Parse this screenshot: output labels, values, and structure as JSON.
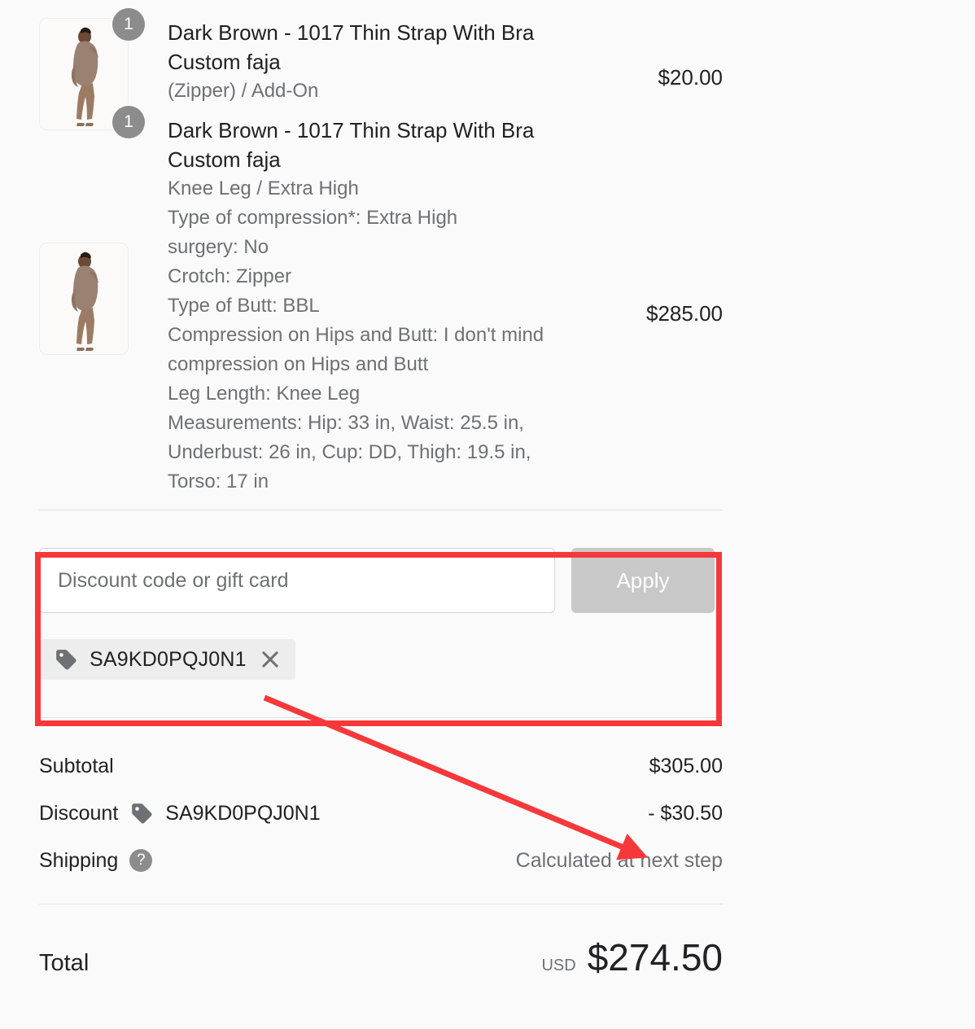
{
  "colors": {
    "background": "#FAFAFA",
    "text": "#202223",
    "muted": "#6D7175",
    "divider": "#E1E3E5",
    "badge": "#8C8C8C",
    "annotation_red": "#F6383A",
    "apply_disabled": "#C8C8C8",
    "chip_background": "#EDEDED"
  },
  "line_items": [
    {
      "quantity": "1",
      "title": "Dark Brown - 1017 Thin Strap With Bra Custom faja",
      "variant": "(Zipper) / Add-On",
      "properties": [],
      "price": "$20.00",
      "thumbnail_alt": "product-photo-brown-faja"
    },
    {
      "quantity": "1",
      "title": "Dark Brown - 1017 Thin Strap With Bra Custom faja",
      "variant": "Knee Leg / Extra High",
      "properties": [
        "Type of compression*: Extra High",
        "surgery: No",
        "Crotch: Zipper",
        "Type of Butt: BBL",
        "Compression on Hips and Butt: I don't mind compression on Hips and Butt",
        "Leg Length: Knee Leg",
        "Measurements: Hip: 33 in, Waist: 25.5 in, Underbust: 26 in, Cup: DD, Thigh: 19.5 in, Torso: 17 in"
      ],
      "price": "$285.00",
      "thumbnail_alt": "product-photo-brown-faja"
    }
  ],
  "discount": {
    "input_value": "",
    "placeholder": "Discount code or gift card",
    "apply_label": "Apply",
    "applied_code": "SA9KD0PQJ0N1",
    "remove_label": "×",
    "tag_icon": "tag-icon"
  },
  "totals": {
    "subtotal": {
      "label": "Subtotal",
      "value": "$305.00"
    },
    "discount": {
      "label": "Discount",
      "code": "SA9KD0PQJ0N1",
      "value": "- $30.50"
    },
    "shipping": {
      "label": "Shipping",
      "help_icon": "?",
      "value": "Calculated at next step"
    },
    "total": {
      "label": "Total",
      "currency": "USD",
      "value": "$274.50"
    }
  }
}
